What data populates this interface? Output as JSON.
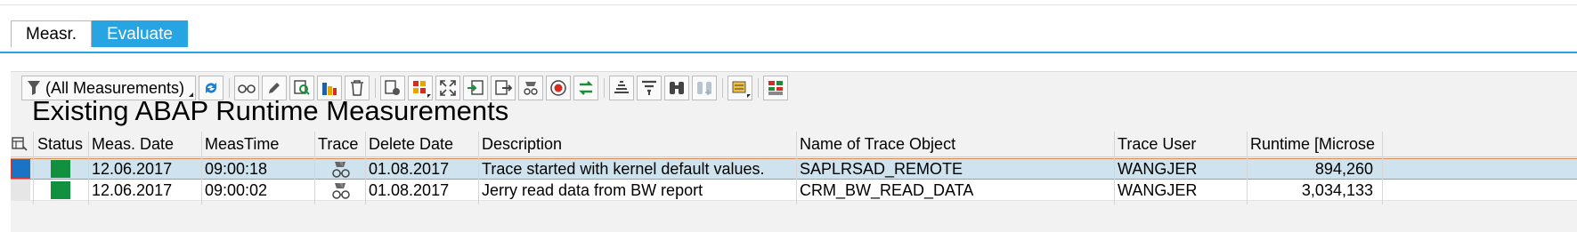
{
  "tabs": [
    {
      "label": "Measr.",
      "active": false
    },
    {
      "label": "Evaluate",
      "active": true
    }
  ],
  "toolbar": {
    "filter_label": "(All Measurements)",
    "buttons": [
      "refresh-icon",
      "glasses-icon",
      "pencil-icon",
      "find-icon",
      "chart-icon",
      "delete-icon",
      "settings-icon",
      "layout-icon",
      "fullscreen-icon",
      "import-icon",
      "export-icon",
      "trace-icon",
      "record-icon",
      "compare-icon",
      "sort-asc-icon",
      "filter-icon",
      "binoculars-icon",
      "binoculars-next-icon",
      "variant-icon",
      "color-grid-icon"
    ]
  },
  "page_title": "Existing ABAP Runtime Measurements",
  "table": {
    "columns": [
      "Status",
      "Meas. Date",
      "MeasTime",
      "Trace",
      "Delete Date",
      "Description",
      "Name of Trace Object",
      "Trace User",
      "Runtime [Microse"
    ],
    "rows": [
      {
        "status": "green",
        "meas_date": "12.06.2017",
        "meas_time": "09:00:18",
        "delete_date": "01.08.2017",
        "description": "Trace started with kernel default values.",
        "trace_object": "SAPLRSAD_REMOTE",
        "trace_user": "WANGJER",
        "runtime": "894,260",
        "selected": true
      },
      {
        "status": "green",
        "meas_date": "12.06.2017",
        "meas_time": "09:00:02",
        "delete_date": "01.08.2017",
        "description": "Jerry read data from BW report",
        "trace_object": "CRM_BW_READ_DATA",
        "trace_user": "WANGJER",
        "runtime": "3,034,133",
        "selected": false
      }
    ]
  },
  "colors": {
    "accent": "#27a5e3",
    "status_green": "#11903f",
    "selected_row": "#cfe3ee",
    "selection_border": "#e08a55"
  }
}
